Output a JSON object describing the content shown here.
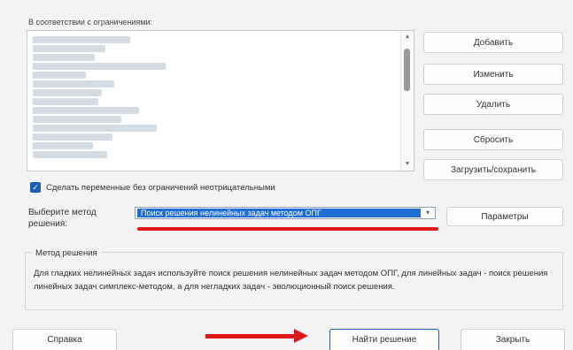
{
  "constraints": {
    "label": "В соответствии с ограничениями:",
    "rows": 14
  },
  "buttons": {
    "add": "Добавить",
    "change": "Изменить",
    "delete": "Удалить",
    "reset": "Сбросить",
    "load_save": "Загрузить/сохранить",
    "parameters": "Параметры",
    "help": "Справка",
    "solve": "Найти решение",
    "close": "Закрыть"
  },
  "checkbox": {
    "label": "Сделать переменные без ограничений неотрицательными",
    "checked": true
  },
  "method": {
    "label": "Выберите метод решения:",
    "selected": "Поиск решения нелинейных задач методом ОПГ"
  },
  "method_group": {
    "title": "Метод решения",
    "description": "Для гладких нелинейных задач используйте поиск решения нелинейных задач методом ОПГ, для линейных задач - поиск решения линейных задач симплекс-методом, а для негладких задач - эволюционный поиск решения."
  },
  "colors": {
    "accent": "#1f6ed6",
    "annotation": "#e01818"
  }
}
